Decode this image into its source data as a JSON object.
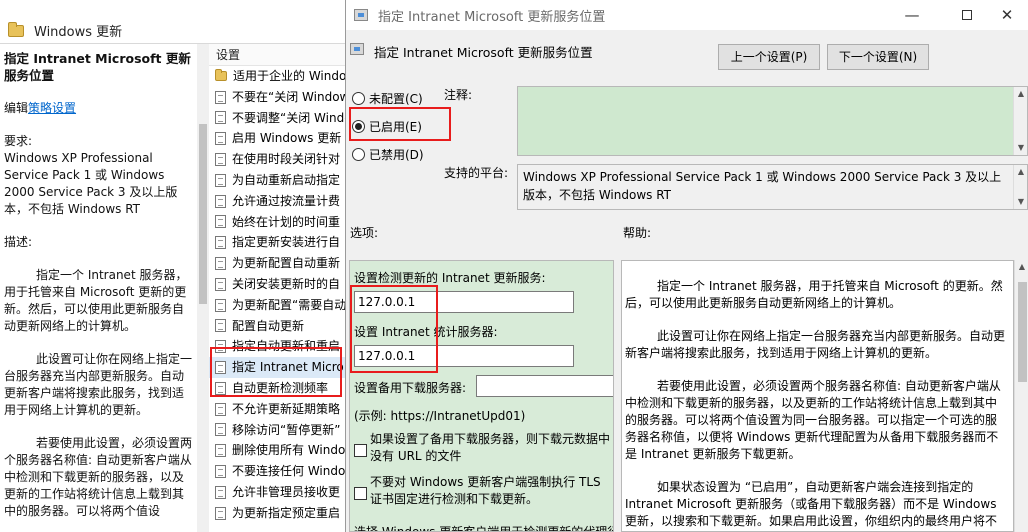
{
  "background_window": {
    "header_title": "Windows 更新",
    "description": {
      "title": "指定 Intranet Microsoft 更新服务位置",
      "edit_prefix": "编辑",
      "edit_link": "策略设置",
      "requirements_label": "要求:",
      "requirements_text": "Windows XP Professional Service Pack 1 或 Windows 2000 Service Pack 3 及以上版本，不包括 Windows RT",
      "desc_label": "描述:",
      "paragraphs": [
        "指定一个 Intranet 服务器，用于托管来自 Microsoft 更新的更新。然后，可以使用此更新服务自动更新网络上的计算机。",
        "此设置可让你在网络上指定一台服务器充当内部更新服务。自动更新客户端将搜索此服务，找到适用于网络上计算机的更新。",
        "若要使用此设置，必须设置两个服务器名称值: 自动更新客户端从中检测和下载更新的服务器，以及更新的工作站将统计信息上载到其中的服务器。可以将两个值设"
      ]
    },
    "settings_header": "设置",
    "settings": [
      {
        "label": "适用于企业的 Windows",
        "type": "folder"
      },
      {
        "label": "不要在“关闭 Windows”",
        "type": "doc"
      },
      {
        "label": "不要调整“关闭 Windows”",
        "type": "doc"
      },
      {
        "label": "启用 Windows 更新",
        "type": "doc"
      },
      {
        "label": "在使用时段关闭针对",
        "type": "doc"
      },
      {
        "label": "为自动重新启动指定",
        "type": "doc"
      },
      {
        "label": "允许通过按流量计费",
        "type": "doc"
      },
      {
        "label": "始终在计划的时间重",
        "type": "doc"
      },
      {
        "label": "指定更新安装进行自",
        "type": "doc"
      },
      {
        "label": "为更新配置自动重新",
        "type": "doc"
      },
      {
        "label": "关闭安装更新时的自",
        "type": "doc"
      },
      {
        "label": "为更新配置“需要自动",
        "type": "doc"
      },
      {
        "label": "配置自动更新",
        "type": "doc"
      },
      {
        "label": "指定自动更新和重启",
        "type": "doc"
      },
      {
        "label": "指定 Intranet Micro",
        "type": "doc"
      },
      {
        "label": "自动更新检测频率",
        "type": "doc"
      },
      {
        "label": "不允许更新延期策略",
        "type": "doc"
      },
      {
        "label": "移除访问“暂停更新”",
        "type": "doc"
      },
      {
        "label": "删除使用所有 Windo",
        "type": "doc"
      },
      {
        "label": "不要连接任何 Windo",
        "type": "doc"
      },
      {
        "label": "允许非管理员接收更",
        "type": "doc"
      },
      {
        "label": "为更新指定预定重启",
        "type": "doc"
      }
    ]
  },
  "dialog": {
    "title": "指定 Intranet Microsoft 更新服务位置",
    "controls": {
      "minimize": "—",
      "close": "✕"
    },
    "setting_name": "指定 Intranet Microsoft 更新服务位置",
    "prev_button": "上一个设置(P)",
    "next_button": "下一个设置(N)",
    "radios": {
      "not_configured": "未配置(C)",
      "enabled": "已启用(E)",
      "disabled": "已禁用(D)",
      "selected": "enabled"
    },
    "comment_label": "注释:",
    "comment_value": "",
    "platform_label": "支持的平台:",
    "platform_text": "Windows XP Professional Service Pack 1 或 Windows 2000 Service Pack 3 及以上版本，不包括 Windows RT",
    "options_label": "选项:",
    "help_label": "帮助:",
    "options": {
      "update_server_label": "设置检测更新的 Intranet 更新服务:",
      "update_server_value": "127.0.0.1",
      "stats_server_label": "设置 Intranet 统计服务器:",
      "stats_server_value": "127.0.0.1",
      "alt_download_label": "设置备用下载服务器:",
      "alt_download_value": "",
      "example_text": "(示例:    https://IntranetUpd01)",
      "check1_text": "如果设置了备用下载服务器，则下载元数据中没有 URL 的文件",
      "check2_text": "不要对 Windows 更新客户端强制执行 TLS 证书固定进行检测和下载更新。",
      "bottom_text": "选择 Windows 更新客户端用于检测更新的代理行为"
    },
    "help_paragraphs": [
      "指定一个 Intranet 服务器，用于托管来自 Microsoft 的更新。然后，可以使用此更新服务自动更新网络上的计算机。",
      "此设置可让你在网络上指定一台服务器充当内部更新服务。自动更新客户端将搜索此服务，找到适用于网络上计算机的更新。",
      "若要使用此设置，必须设置两个服务器名称值: 自动更新客户端从中检测和下载更新的服务器，以及更新的工作站将统计信息上载到其中的服务器。可以将两个值设置为同一台服务器。可以指定一个可选的服务器名称值，以便将 Windows 更新代理配置为从备用下载服务器而不是 Intranet 更新服务下载更新。",
      "如果状态设置为 “已启用”，自动更新客户端会连接到指定的 Intranet Microsoft 更新服务（或备用下载服务器）而不是 Windows 更新，以搜索和下载更新。如果启用此设置，你组织内的最终用户将不必"
    ]
  }
}
